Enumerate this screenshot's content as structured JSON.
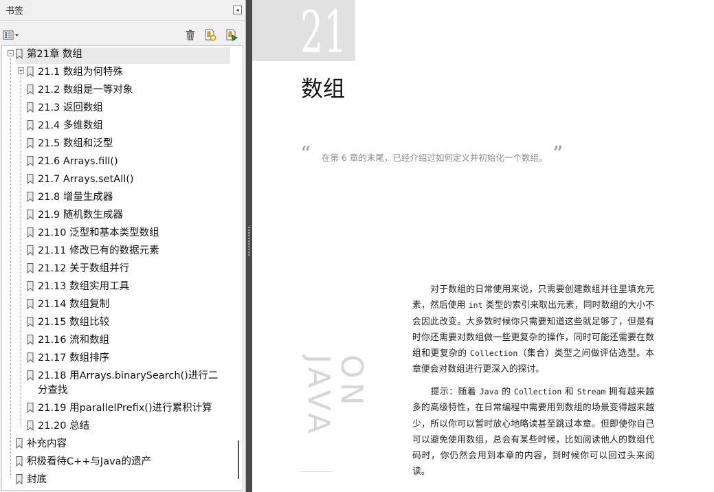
{
  "sidebar": {
    "title": "书签",
    "collapse_glyph": "◂",
    "toolbar": {
      "options_icon": "options-menu-icon",
      "delete_icon": "trash-icon",
      "new_icon": "new-bookmark-icon",
      "expand_icon": "expand-bookmark-icon"
    },
    "bookmarks": {
      "root_label": "第21章 数组",
      "root_expander": "−",
      "first_child_expander": "+",
      "children": [
        "21.1 数组为何特殊",
        "21.2 数组是一等对象",
        "21.3 返回数组",
        "21.4 多维数组",
        "21.5 数组和泛型",
        "21.6 Arrays.fill()",
        "21.7 Arrays.setAll()",
        "21.8 增量生成器",
        "21.9 随机数生成器",
        "21.10 泛型和基本类型数组",
        "21.11 修改已有的数据元素",
        "21.12 关于数组并行",
        "21.13 数组实用工具",
        "21.14 数组复制",
        "21.15 数组比较",
        "21.16 流和数组",
        "21.17 数组排序",
        "21.18 用Arrays.binarySearch()进行二分查找",
        "21.19 用parallelPrefix()进行累积计算",
        "21.20 总结"
      ],
      "siblings": [
        "补充内容",
        "积极看待C++与Java的遗产",
        "封底"
      ]
    }
  },
  "document": {
    "chapter_number": "21",
    "chapter_title": "数组",
    "quote_open": "“",
    "quote_text": "在第 6 章的末尾，已经介绍过如何定义并初始化一个数组。",
    "quote_close": "”",
    "vertical_text": "ON JAVA",
    "para1_a": "对于数组的日常使用来说，只需要创建数组并往里填充元素，然后使用 ",
    "para1_code1": "int",
    "para1_b": " 类型的索引来取出元素，同时数组的大小不会因此改变。大多数时候你只需要知道这些就足够了，但是有时你还需要对数组做一些更复杂的操作，同时可能还需要在数组和更复杂的 ",
    "para1_code2": "Collection",
    "para1_c": "（集合）类型之间做评估选型。本章便会对数组进行更深入的探讨。",
    "para2_label": "提示：",
    "para2_a": "随着 ",
    "para2_code1": "Java",
    "para2_b": " 的 ",
    "para2_code2": "Collection",
    "para2_c": " 和 ",
    "para2_code3": "Stream",
    "para2_d": " 拥有越来越多的高级特性，在日常编程中需要用到数组的场景变得越来越少，所以你可以暂时放心地略读甚至跳过本章。但即使你自己可以避免使用数组，总会有某些时候，比如阅读他人的数组代码时，你仍然会用到本章的内容，到时候你可以回过头来阅读。"
  },
  "colors": {
    "panel_bg": "#f0f0f0",
    "splitter": "#4a4a4a",
    "chapter_block": "#e1e1e1",
    "quote_text": "#8a8a8a"
  }
}
